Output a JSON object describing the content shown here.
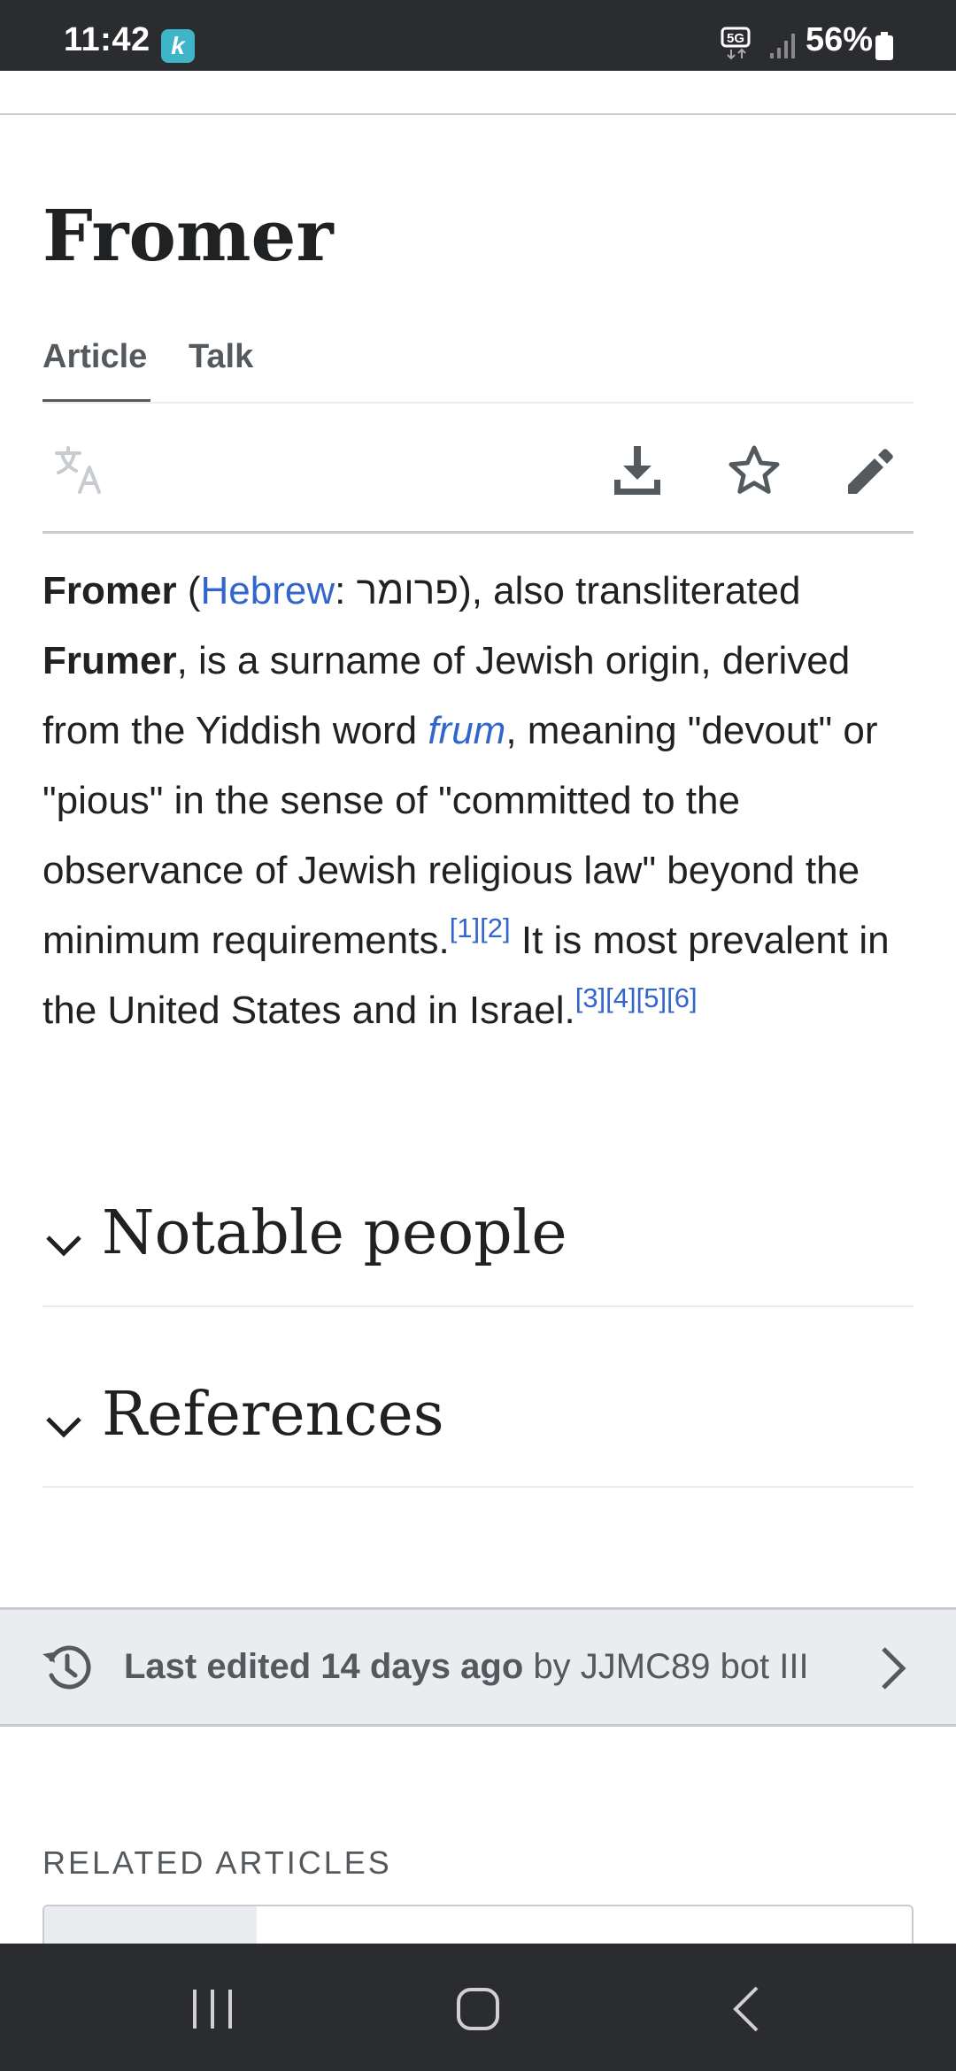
{
  "status_bar": {
    "time": "11:42",
    "app_icon_glyph": "k",
    "battery": "56%",
    "network_label": "5G"
  },
  "page": {
    "title": "Fromer"
  },
  "tabs": [
    {
      "label": "Article",
      "active": true
    },
    {
      "label": "Talk",
      "active": false
    }
  ],
  "toolbar": {
    "icons": [
      "translate-icon",
      "download-icon",
      "star-icon",
      "edit-pencil-icon"
    ]
  },
  "article": {
    "p1_bold_1": "Fromer",
    "p1_open": " (",
    "p1_hebrew_link": "Hebrew",
    "p1_hebrew_text": ": פרומר), also transliterated ",
    "p1_bold_2": "Frumer",
    "p1_text_2": ", is a surname of Jewish origin, derived from the Yiddish word ",
    "p1_frum_link": "frum",
    "p1_text_3": ", meaning \"devout\" or \"pious\" in the sense of \"committed to the observance of Jewish religious law\" beyond the minimum requirements.",
    "ref_1": "[1]",
    "ref_2": "[2]",
    "p1_text_4": " It is most prevalent in the United States and in Israel.",
    "ref_3": "[3]",
    "ref_4": "[4]",
    "ref_5": "[5]",
    "ref_6": "[6]"
  },
  "sections": [
    {
      "title": "Notable people"
    },
    {
      "title": "References"
    }
  ],
  "last_edited": {
    "strong": "Last edited 14 days ago",
    "by": " by JJMC89 bot III"
  },
  "related": {
    "heading": "RELATED ARTICLES"
  },
  "colors": {
    "link": "#3366cc",
    "text": "#202122",
    "muted": "#54595d",
    "bar": "#2b2c30"
  }
}
